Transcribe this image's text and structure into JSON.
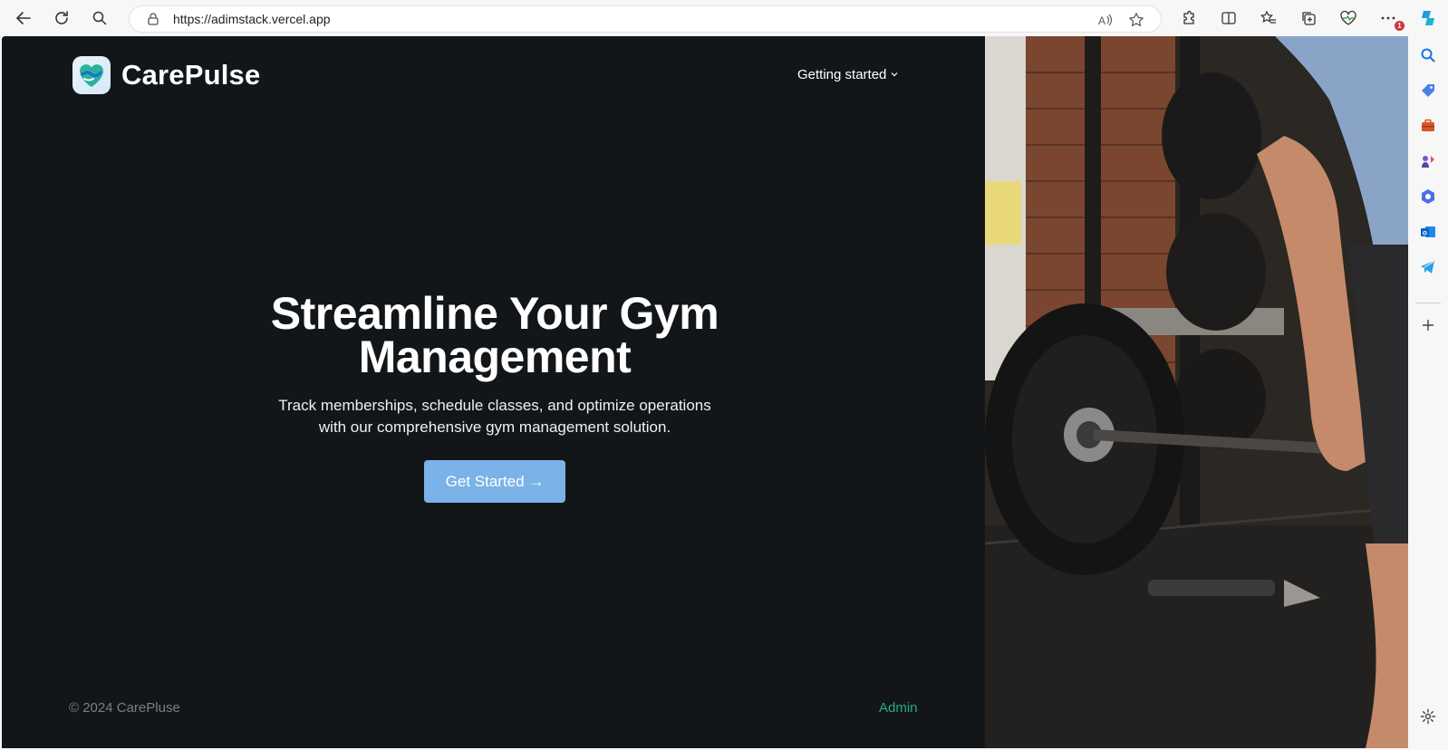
{
  "browser": {
    "url": "https://adimstack.vercel.app",
    "notification_count": "1"
  },
  "site": {
    "brand": "CarePulse",
    "nav": {
      "getting_started": "Getting started"
    },
    "hero": {
      "title_line1": "Streamline Your Gym",
      "title_line2": "Management",
      "subtitle_line1": "Track memberships, schedule classes, and optimize operations",
      "subtitle_line2": "with our comprehensive gym management solution.",
      "cta_label": "Get Started →"
    },
    "footer": {
      "copyright": "© 2024 CarePluse",
      "admin_link": "Admin"
    }
  },
  "colors": {
    "background": "#131619",
    "cta": "#7bb3e8",
    "admin_link": "#24ae7c",
    "footer_text": "#7a7f86"
  },
  "icons": [
    "back-icon",
    "refresh-icon",
    "search-icon",
    "lock-icon",
    "read-aloud-icon",
    "favorite-star-icon",
    "extensions-icon",
    "split-screen-icon",
    "favorites-icon",
    "collections-icon",
    "health-icon",
    "more-icon",
    "copilot-icon",
    "sidebar-search-icon",
    "shopping-tag-icon",
    "tools-icon",
    "games-icon",
    "microsoft365-icon",
    "outlook-icon",
    "telegram-icon",
    "add-icon",
    "settings-icon",
    "chevron-down-icon",
    "carepulse-logo-icon"
  ]
}
